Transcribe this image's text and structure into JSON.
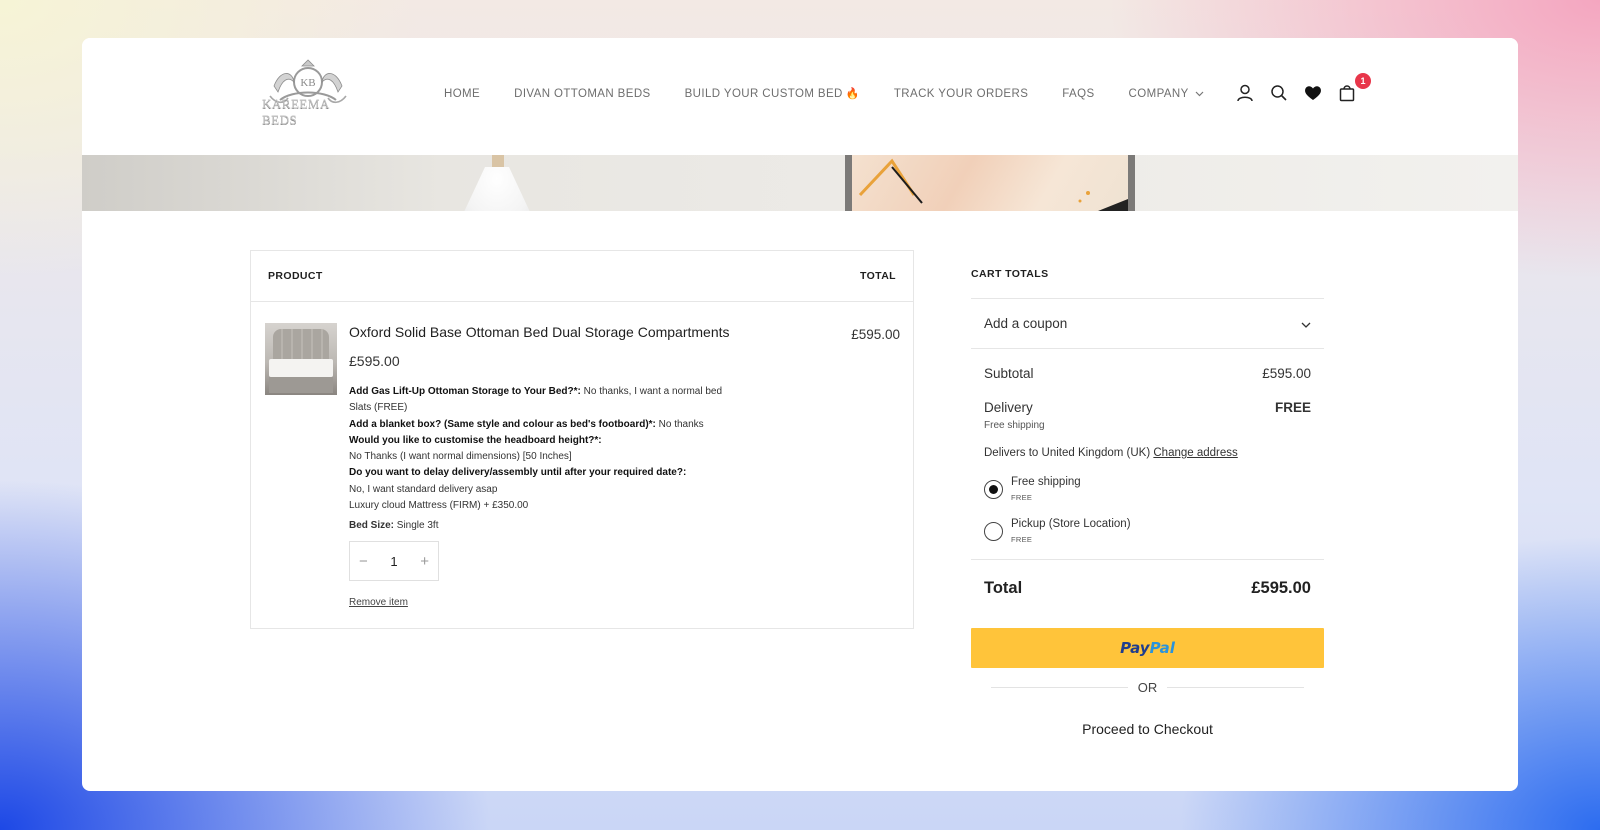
{
  "header": {
    "logo_initials": "KB",
    "logo_text": "KAREEMA BEDS",
    "nav": [
      {
        "label": "HOME"
      },
      {
        "label": "DIVAN OTTOMAN BEDS"
      },
      {
        "label": "BUILD YOUR CUSTOM BED"
      },
      {
        "label": "TRACK YOUR ORDERS"
      },
      {
        "label": "FAQS"
      },
      {
        "label": "COMPANY"
      }
    ],
    "flame_glyph": "🔥",
    "cart_count": "1",
    "icons": [
      "user-icon",
      "search-icon",
      "heart-icon",
      "shopping-bag-icon"
    ]
  },
  "cart": {
    "head_product": "PRODUCT",
    "head_total": "TOTAL",
    "item": {
      "name": "Oxford Solid Base Ottoman Bed Dual Storage Compartments",
      "price": "£595.00",
      "line_total": "£595.00",
      "options": [
        {
          "label": "Add Gas Lift-Up Ottoman Storage to Your Bed?*:",
          "value": " No thanks, I want a normal bed"
        },
        {
          "label": "",
          "value": "Slats (FREE)"
        },
        {
          "label": "Add a blanket box? (Same style and colour as bed's footboard)*:",
          "value": " No thanks"
        },
        {
          "label": "Would you like to customise the headboard height?*:",
          "value": ""
        },
        {
          "label": "",
          "value": "No Thanks (I want normal dimensions) [50 Inches]"
        },
        {
          "label": "Do you want to delay delivery/assembly until after your required date?:",
          "value": ""
        },
        {
          "label": "",
          "value": "No, I want standard delivery asap"
        },
        {
          "label": "",
          "value": "Luxury cloud Mattress (FIRM) + £350.00"
        }
      ],
      "bed_size_label": "Bed Size:",
      "bed_size_value": " Single 3ft",
      "quantity": "1",
      "minus": "−",
      "plus": "+",
      "remove_label": "Remove item"
    }
  },
  "totals": {
    "title": "CART TOTALS",
    "coupon_label": "Add a coupon",
    "subtotal_label": "Subtotal",
    "subtotal_value": "£595.00",
    "delivery_label": "Delivery",
    "delivery_value": "FREE",
    "delivery_note": "Free shipping",
    "delivers_to": "Delivers to United Kingdom (UK) ",
    "change_address": "Change address",
    "shipping_options": [
      {
        "name": "Free shipping",
        "price": "FREE",
        "selected": true
      },
      {
        "name": "Pickup (Store Location)",
        "price": "FREE",
        "selected": false
      }
    ],
    "total_label": "Total",
    "total_value": "£595.00",
    "paypal_pay": "Pay",
    "paypal_pal": "Pal",
    "or_label": "OR",
    "checkout_label": "Proceed to Checkout"
  },
  "colors": {
    "paypal_button": "#ffc43a",
    "badge": "#e8364a"
  }
}
